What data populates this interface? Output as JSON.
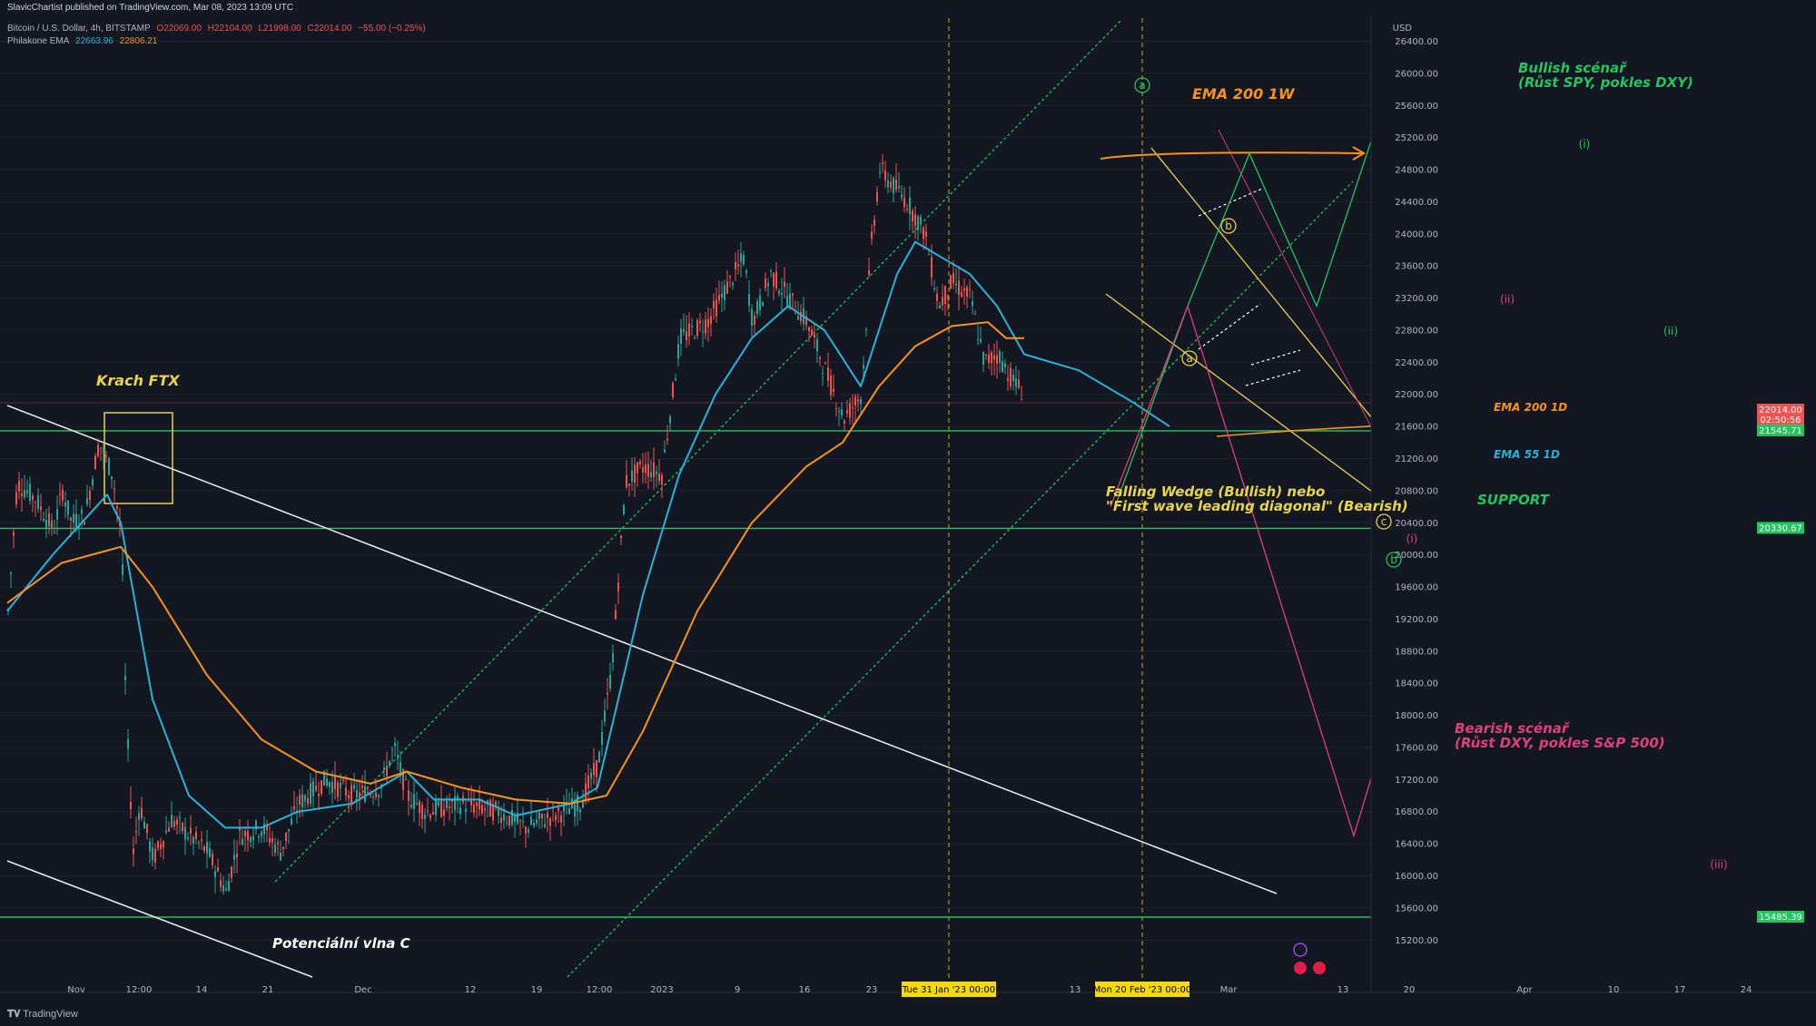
{
  "header": {
    "published": "SlavicChartist published on TradingView.com, Mar 08, 2023 13:09 UTC",
    "symbol": "Bitcoin / U.S. Dollar, 4h, BITSTAMP",
    "ohlc": {
      "o": "O22069.00",
      "h": "H22104.00",
      "l": "L21998.00",
      "c": "C22014.00",
      "chg": "−55.00 (−0.25%)"
    },
    "indicator": {
      "name": "Philakone EMA",
      "v1": "22663.96",
      "v2": "22806.21"
    }
  },
  "footer": {
    "brand": "TradingView"
  },
  "colors": {
    "bg": "#131722",
    "candle_up": "#26a69a",
    "candle_down": "#ef5350",
    "ema55": "#2bb2d6",
    "ema200": "#f7931a",
    "support": "#22c55e",
    "yellow": "#e8d44d",
    "bull": "#22c55e",
    "bear": "#e0407a",
    "text": "#b2b5be"
  },
  "chart_data": {
    "type": "line",
    "title": "Bitcoin / U.S. Dollar, 4h, BITSTAMP",
    "y_currency": "USD",
    "ylim": [
      14800,
      26800
    ],
    "y_ticks": [
      15200,
      15600,
      16000,
      16400,
      16800,
      17200,
      17600,
      18000,
      18400,
      18800,
      19200,
      19600,
      20000,
      20400,
      20800,
      21200,
      21600,
      22000,
      22400,
      22800,
      23200,
      23600,
      24000,
      24400,
      24800,
      25200,
      25600,
      26000,
      26400
    ],
    "x_ticks": [
      "Nov",
      "12:00",
      "14",
      "21",
      "Dec",
      "12",
      "19",
      "12:00",
      "2023",
      "9",
      "16",
      "23",
      "Tue 31 Jan '23   00:00",
      "13",
      "Mon 20 Feb '23   00:00",
      "Mar",
      "13",
      "20",
      "Apr",
      "10",
      "17",
      "24"
    ],
    "price_labels": [
      {
        "value": 22014.0,
        "text": "22014.00",
        "sub": "02:50:56",
        "color": "#ef5350"
      },
      {
        "value": 21545.71,
        "text": "21545.71",
        "color": "#22c55e"
      },
      {
        "value": 20330.67,
        "text": "20330.67",
        "color": "#22c55e"
      },
      {
        "value": 15485.39,
        "text": "15485.39",
        "color": "#22c55e"
      }
    ],
    "price_path": [
      {
        "t": 0,
        "p": 19300
      },
      {
        "t": 10,
        "p": 20900
      },
      {
        "t": 30,
        "p": 20700
      },
      {
        "t": 50,
        "p": 20300
      },
      {
        "t": 60,
        "p": 20800
      },
      {
        "t": 70,
        "p": 20400
      },
      {
        "t": 85,
        "p": 20500
      },
      {
        "t": 100,
        "p": 21400
      },
      {
        "t": 115,
        "p": 21000
      },
      {
        "t": 125,
        "p": 20200
      },
      {
        "t": 130,
        "p": 18000
      },
      {
        "t": 138,
        "p": 16300
      },
      {
        "t": 145,
        "p": 16900
      },
      {
        "t": 160,
        "p": 16200
      },
      {
        "t": 180,
        "p": 16700
      },
      {
        "t": 200,
        "p": 16500
      },
      {
        "t": 220,
        "p": 16300
      },
      {
        "t": 240,
        "p": 15800
      },
      {
        "t": 255,
        "p": 16500
      },
      {
        "t": 280,
        "p": 16600
      },
      {
        "t": 300,
        "p": 16300
      },
      {
        "t": 320,
        "p": 16900
      },
      {
        "t": 350,
        "p": 17200
      },
      {
        "t": 380,
        "p": 17000
      },
      {
        "t": 410,
        "p": 17100
      },
      {
        "t": 425,
        "p": 17600
      },
      {
        "t": 440,
        "p": 17000
      },
      {
        "t": 460,
        "p": 16800
      },
      {
        "t": 500,
        "p": 16900
      },
      {
        "t": 540,
        "p": 16800
      },
      {
        "t": 570,
        "p": 16600
      },
      {
        "t": 600,
        "p": 16750
      },
      {
        "t": 630,
        "p": 16900
      },
      {
        "t": 650,
        "p": 17400
      },
      {
        "t": 665,
        "p": 18600
      },
      {
        "t": 680,
        "p": 20900
      },
      {
        "t": 700,
        "p": 21100
      },
      {
        "t": 720,
        "p": 21000
      },
      {
        "t": 740,
        "p": 22700
      },
      {
        "t": 770,
        "p": 22900
      },
      {
        "t": 810,
        "p": 23700
      },
      {
        "t": 820,
        "p": 22900
      },
      {
        "t": 840,
        "p": 23500
      },
      {
        "t": 860,
        "p": 23200
      },
      {
        "t": 880,
        "p": 22900
      },
      {
        "t": 900,
        "p": 22300
      },
      {
        "t": 920,
        "p": 21700
      },
      {
        "t": 940,
        "p": 22000
      },
      {
        "t": 950,
        "p": 23800
      },
      {
        "t": 960,
        "p": 24800
      },
      {
        "t": 975,
        "p": 24600
      },
      {
        "t": 990,
        "p": 24400
      },
      {
        "t": 1010,
        "p": 24000
      },
      {
        "t": 1025,
        "p": 23100
      },
      {
        "t": 1040,
        "p": 23400
      },
      {
        "t": 1060,
        "p": 23200
      },
      {
        "t": 1075,
        "p": 22400
      },
      {
        "t": 1090,
        "p": 22500
      },
      {
        "t": 1105,
        "p": 22200
      },
      {
        "t": 1118,
        "p": 22014
      }
    ],
    "series": [
      {
        "name": "",
        "color": "#2bb2d6",
        "points": [
          {
            "t": 0,
            "p": 19300
          },
          {
            "t": 50,
            "p": 20000
          },
          {
            "t": 110,
            "p": 20750
          },
          {
            "t": 125,
            "p": 20400
          },
          {
            "t": 160,
            "p": 18200
          },
          {
            "t": 200,
            "p": 17000
          },
          {
            "t": 240,
            "p": 16600
          },
          {
            "t": 280,
            "p": 16600
          },
          {
            "t": 320,
            "p": 16800
          },
          {
            "t": 380,
            "p": 16900
          },
          {
            "t": 440,
            "p": 17300
          },
          {
            "t": 470,
            "p": 16950
          },
          {
            "t": 520,
            "p": 16950
          },
          {
            "t": 560,
            "p": 16750
          },
          {
            "t": 620,
            "p": 16900
          },
          {
            "t": 650,
            "p": 17100
          },
          {
            "t": 700,
            "p": 19500
          },
          {
            "t": 740,
            "p": 21000
          },
          {
            "t": 780,
            "p": 22000
          },
          {
            "t": 820,
            "p": 22700
          },
          {
            "t": 860,
            "p": 23100
          },
          {
            "t": 900,
            "p": 22800
          },
          {
            "t": 940,
            "p": 22100
          },
          {
            "t": 980,
            "p": 23500
          },
          {
            "t": 1000,
            "p": 23900
          },
          {
            "t": 1030,
            "p": 23700
          },
          {
            "t": 1060,
            "p": 23500
          },
          {
            "t": 1090,
            "p": 23100
          },
          {
            "t": 1120,
            "p": 22500
          },
          {
            "t": 1180,
            "p": 22300
          },
          {
            "t": 1240,
            "p": 21900
          },
          {
            "t": 1280,
            "p": 21600
          }
        ]
      },
      {
        "name": "",
        "color": "#f7931a",
        "points": [
          {
            "t": 0,
            "p": 19400
          },
          {
            "t": 60,
            "p": 19900
          },
          {
            "t": 125,
            "p": 20100
          },
          {
            "t": 160,
            "p": 19600
          },
          {
            "t": 220,
            "p": 18500
          },
          {
            "t": 280,
            "p": 17700
          },
          {
            "t": 340,
            "p": 17300
          },
          {
            "t": 400,
            "p": 17150
          },
          {
            "t": 440,
            "p": 17300
          },
          {
            "t": 500,
            "p": 17100
          },
          {
            "t": 560,
            "p": 16950
          },
          {
            "t": 620,
            "p": 16900
          },
          {
            "t": 660,
            "p": 17000
          },
          {
            "t": 700,
            "p": 17800
          },
          {
            "t": 760,
            "p": 19300
          },
          {
            "t": 820,
            "p": 20400
          },
          {
            "t": 880,
            "p": 21100
          },
          {
            "t": 920,
            "p": 21400
          },
          {
            "t": 960,
            "p": 22100
          },
          {
            "t": 1000,
            "p": 22600
          },
          {
            "t": 1040,
            "p": 22850
          },
          {
            "t": 1080,
            "p": 22900
          },
          {
            "t": 1100,
            "p": 22700
          },
          {
            "t": 1120,
            "p": 22700
          }
        ]
      }
    ],
    "annotations": [
      {
        "text": "Krach FTX",
        "color": "#e8d44d"
      },
      {
        "text": "Potenciální vlna C",
        "color": "#ffffff"
      },
      {
        "text": "EMA 200 1W",
        "color": "#f7931a"
      },
      {
        "text": "Bullish scénař",
        "color": "#22c55e"
      },
      {
        "text": "(Růst SPY, pokles DXY)",
        "color": "#22c55e"
      },
      {
        "text": "Falling Wedge (Bullish) nebo",
        "color": "#e8d44d"
      },
      {
        "text": "\"First wave leading diagonal\" (Bearish)",
        "color": "#e8d44d"
      },
      {
        "text": "SUPPORT",
        "color": "#22c55e"
      },
      {
        "text": "EMA 200 1D",
        "color": "#f7931a"
      },
      {
        "text": "EMA 55 1D",
        "color": "#2bb2d6"
      },
      {
        "text": "Bearish scénař",
        "color": "#e0407a"
      },
      {
        "text": "(Růst DXY, pokles S&P 500)",
        "color": "#e0407a"
      }
    ],
    "wave_labels": [
      "a",
      "b",
      "c",
      "a",
      "b",
      "(i)",
      "(ii)",
      "(i)",
      "(ii)",
      "(iii)"
    ],
    "bullish_scenario": [
      {
        "t": 1220,
        "p": 20600
      },
      {
        "t": 1300,
        "p": 23100
      },
      {
        "t": 1368,
        "p": 25000
      },
      {
        "t": 1442,
        "p": 23100
      },
      {
        "t": 1515,
        "p": 25600
      }
    ],
    "bearish_scenario": [
      {
        "t": 1215,
        "p": 20600
      },
      {
        "t": 1300,
        "p": 23100
      },
      {
        "t": 1483,
        "p": 16500
      },
      {
        "t": 1515,
        "p": 17700
      }
    ]
  }
}
